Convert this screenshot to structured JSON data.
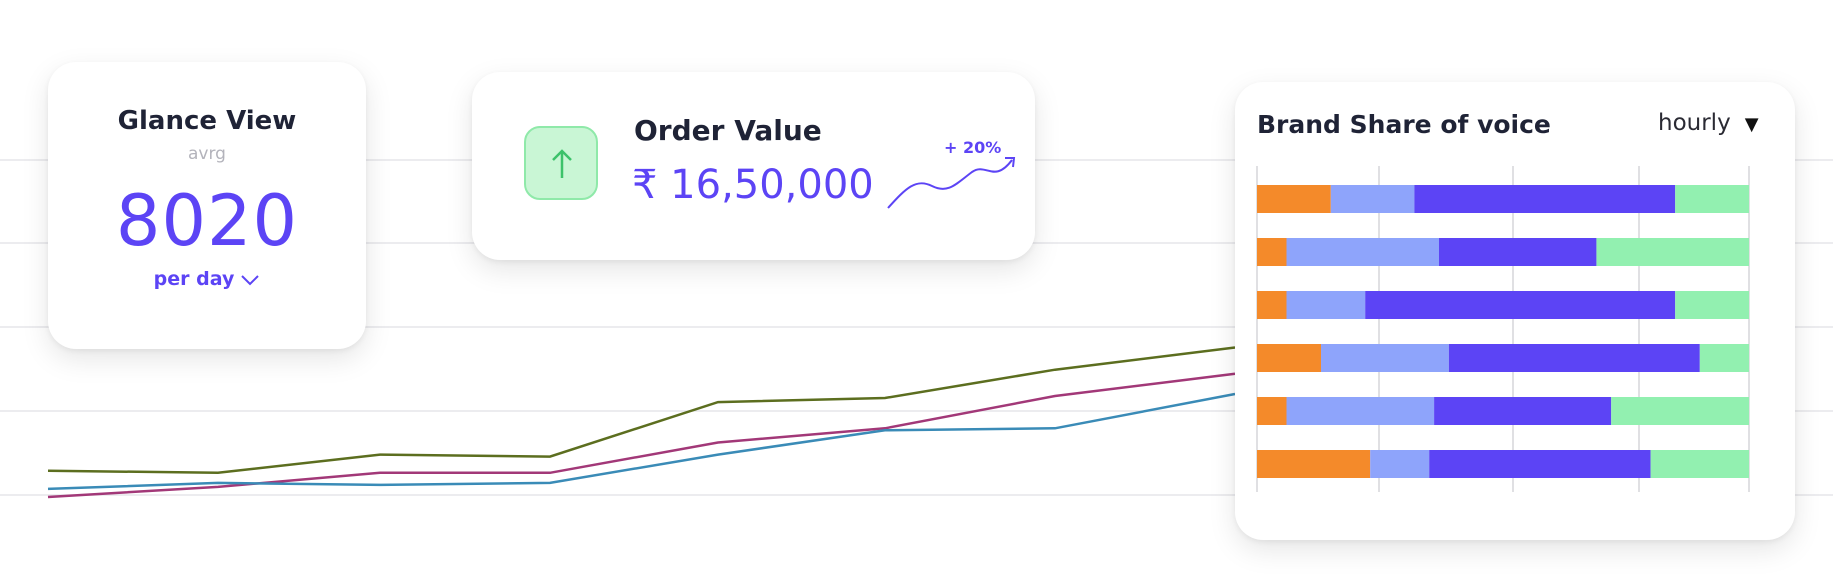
{
  "background_chart": {
    "series": [
      {
        "color": "#5c6e1f",
        "values": [
          0.13,
          0.12,
          0.21,
          0.2,
          0.47,
          0.49,
          0.63,
          0.74
        ]
      },
      {
        "color": "#a23878",
        "values": [
          0.0,
          0.05,
          0.12,
          0.12,
          0.27,
          0.34,
          0.5,
          0.61
        ]
      },
      {
        "color": "#3a8bb7",
        "values": [
          0.04,
          0.07,
          0.06,
          0.07,
          0.21,
          0.33,
          0.34,
          0.51
        ]
      }
    ]
  },
  "glance": {
    "title": "Glance View",
    "subtitle": "avrg",
    "value": "8020",
    "period": "per day"
  },
  "order": {
    "title": "Order Value",
    "value": "₹ 16,50,000",
    "change": "+ 20%",
    "accent": "#5c44f5"
  },
  "brand": {
    "title": "Brand Share of voice",
    "dropdown_value": "hourly",
    "chart_data": {
      "type": "bar",
      "orientation": "horizontal",
      "stacked": "percent",
      "colors": [
        "#f48a2a",
        "#8ea4fb",
        "#5c44f5",
        "#92f0b0"
      ],
      "rows": [
        [
          15,
          17,
          53,
          15
        ],
        [
          6,
          31,
          32,
          31
        ],
        [
          6,
          16,
          63,
          15
        ],
        [
          13,
          26,
          51,
          10
        ],
        [
          6,
          30,
          36,
          28
        ],
        [
          23,
          12,
          45,
          20
        ]
      ],
      "xlim": [
        0,
        100
      ],
      "grid": true
    }
  }
}
